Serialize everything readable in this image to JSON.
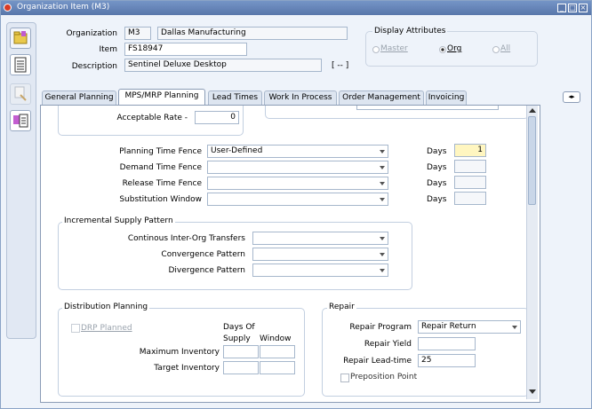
{
  "window": {
    "title": "Organization Item (M3)"
  },
  "header": {
    "organization_label": "Organization",
    "organization_code": "M3",
    "organization_name": "Dallas Manufacturing",
    "item_label": "Item",
    "item_value": "FS18947",
    "description_label": "Description",
    "description_value": "Sentinel Deluxe Desktop",
    "flex_button": "[ -- ]"
  },
  "display_attributes": {
    "title": "Display Attributes",
    "options": [
      "Master",
      "Org",
      "All"
    ],
    "selected": "Org"
  },
  "tabs": [
    "General Planning",
    "MPS/MRP Planning",
    "Lead Times",
    "Work In Process",
    "Order Management",
    "Invoicing"
  ],
  "active_tab": "MPS/MRP Planning",
  "panel": {
    "acceptable_rate_label": "Acceptable Rate -",
    "acceptable_rate_value": "0",
    "planning_time_fence_label": "Planning Time Fence",
    "planning_time_fence_value": "User-Defined",
    "demand_time_fence_label": "Demand Time Fence",
    "release_time_fence_label": "Release Time Fence",
    "substitution_window_label": "Substitution Window",
    "days_label": "Days",
    "planning_time_fence_days": "1",
    "incremental": {
      "title": "Incremental Supply Pattern",
      "inter_org_label": "Continous Inter-Org Transfers",
      "convergence_label": "Convergence Pattern",
      "divergence_label": "Divergence Pattern"
    },
    "distribution": {
      "title": "Distribution Planning",
      "drp_planned_label": "DRP Planned",
      "days_of_label": "Days Of",
      "supply_label": "Supply",
      "window_label": "Window",
      "max_inventory_label": "Maximum Inventory",
      "target_inventory_label": "Target Inventory"
    },
    "repair": {
      "title": "Repair",
      "program_label": "Repair Program",
      "program_value": "Repair Return",
      "yield_label": "Repair Yield",
      "lead_time_label": "Repair Lead-time",
      "lead_time_value": "25",
      "preposition_label": "Preposition Point"
    }
  }
}
